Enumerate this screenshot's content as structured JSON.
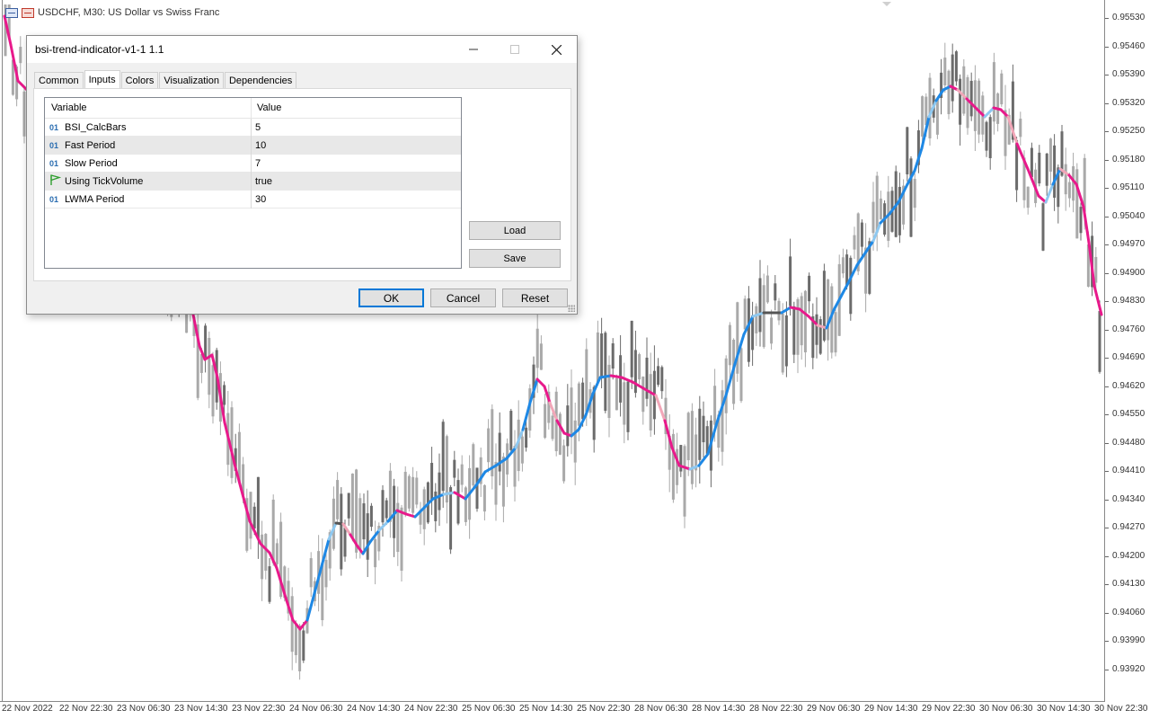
{
  "chart": {
    "header_symbol": "USDCHF, M30:  US Dollar vs Swiss Franc",
    "price_labels": [
      "0.95530",
      "0.95460",
      "0.95390",
      "0.95320",
      "0.95250",
      "0.95180",
      "0.95110",
      "0.95040",
      "0.94970",
      "0.94900",
      "0.94830",
      "0.94760",
      "0.94690",
      "0.94620",
      "0.94550",
      "0.94480",
      "0.94410",
      "0.94340",
      "0.94270",
      "0.94200",
      "0.94130",
      "0.94060",
      "0.93990",
      "0.93920"
    ],
    "time_labels": [
      "22 Nov 2022",
      "22 Nov 22:30",
      "23 Nov 06:30",
      "23 Nov 14:30",
      "23 Nov 22:30",
      "24 Nov 06:30",
      "24 Nov 14:30",
      "24 Nov 22:30",
      "25 Nov 06:30",
      "25 Nov 14:30",
      "25 Nov 22:30",
      "28 Nov 06:30",
      "28 Nov 14:30",
      "28 Nov 22:30",
      "29 Nov 06:30",
      "29 Nov 14:30",
      "29 Nov 22:30",
      "30 Nov 06:30",
      "30 Nov 14:30",
      "30 Nov 22:30"
    ],
    "colors": {
      "candle": "#a9a9a9",
      "candle_dark": "#6b6b6b",
      "bear_strong": "#e8198b",
      "bear_weak": "#f2a7b8",
      "bull_strong": "#1e88e5",
      "bull_weak": "#8ec8f0",
      "neutral": "#555555"
    }
  },
  "dialog": {
    "title": "bsi-trend-indicator-v1-1 1.1",
    "tabs": [
      "Common",
      "Inputs",
      "Colors",
      "Visualization",
      "Dependencies"
    ],
    "active_tab": "Inputs",
    "columns": {
      "variable": "Variable",
      "value": "Value"
    },
    "rows": [
      {
        "icon": "01",
        "name": "BSI_CalcBars",
        "value": "5"
      },
      {
        "icon": "01",
        "name": "Fast Period",
        "value": "10"
      },
      {
        "icon": "01",
        "name": "Slow Period",
        "value": "7"
      },
      {
        "icon": "flag",
        "name": "Using TickVolume",
        "value": "true"
      },
      {
        "icon": "01",
        "name": "LWMA Period",
        "value": "30"
      }
    ],
    "buttons": {
      "load": "Load",
      "save": "Save",
      "ok": "OK",
      "cancel": "Cancel",
      "reset": "Reset"
    }
  }
}
